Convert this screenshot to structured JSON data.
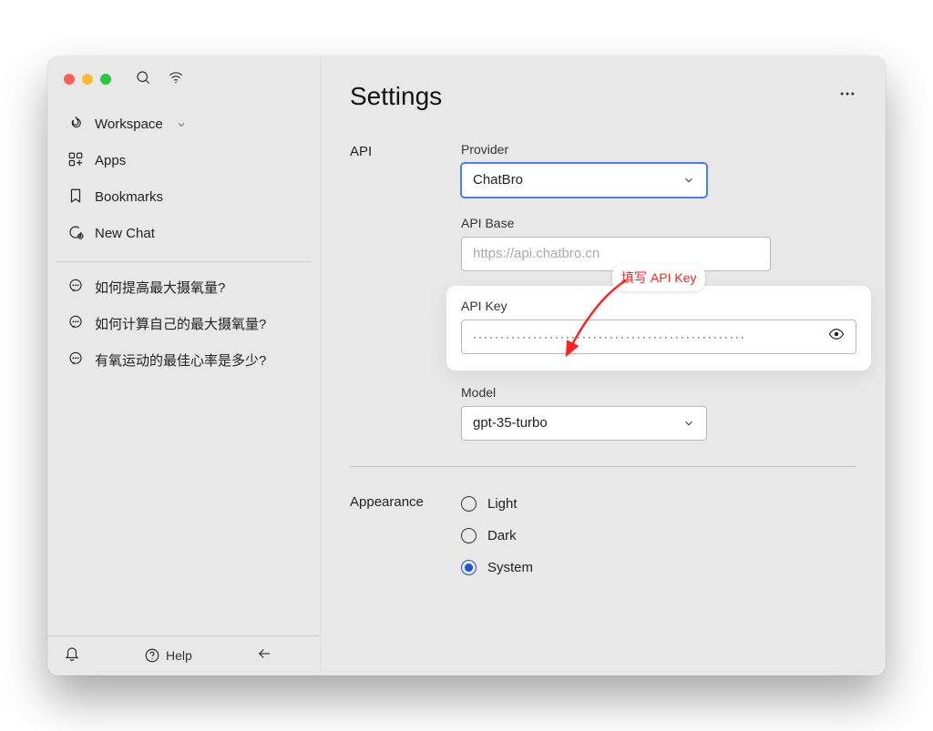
{
  "sidebar": {
    "workspace_label": "Workspace",
    "apps_label": "Apps",
    "bookmarks_label": "Bookmarks",
    "newchat_label": "New Chat",
    "chats": [
      "如何提高最大摄氧量?",
      "如何计算自己的最大摄氧量?",
      "有氧运动的最佳心率是多少?"
    ],
    "help_label": "Help"
  },
  "page": {
    "title": "Settings"
  },
  "api": {
    "section_label": "API",
    "provider_label": "Provider",
    "provider_value": "ChatBro",
    "apibase_label": "API Base",
    "apibase_placeholder": "https://api.chatbro.cn",
    "apikey_label": "API Key",
    "apikey_masked": "··················································",
    "model_label": "Model",
    "model_value": "gpt-35-turbo"
  },
  "appearance": {
    "section_label": "Appearance",
    "options": [
      "Light",
      "Dark",
      "System"
    ],
    "selected": "System"
  },
  "callout": {
    "text": "填写 API Key"
  }
}
